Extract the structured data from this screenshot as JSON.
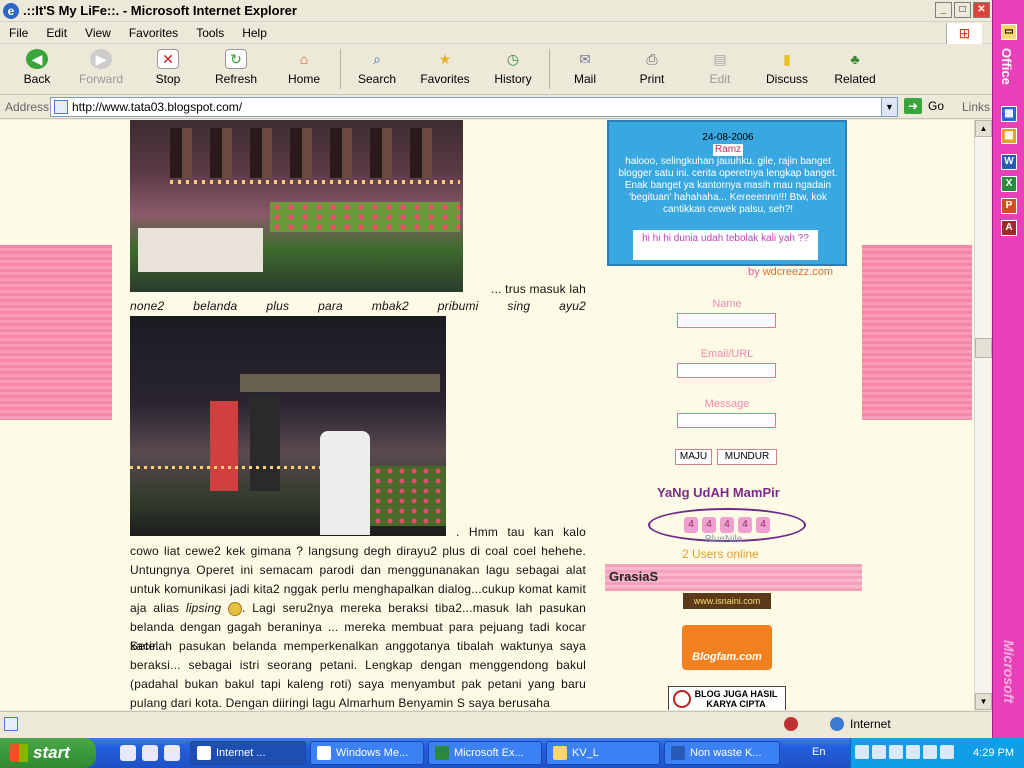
{
  "window": {
    "title": ".::It'S My LiFe::. - Microsoft Internet Explorer"
  },
  "menu": [
    "File",
    "Edit",
    "View",
    "Favorites",
    "Tools",
    "Help"
  ],
  "toolbar": {
    "back": "Back",
    "forward": "Forward",
    "stop": "Stop",
    "refresh": "Refresh",
    "home": "Home",
    "search": "Search",
    "favorites": "Favorites",
    "history": "History",
    "mail": "Mail",
    "print": "Print",
    "edit": "Edit",
    "discuss": "Discuss",
    "related": "Related"
  },
  "address": {
    "label": "Address",
    "url": "http://www.tata03.blogspot.com/",
    "go": "Go",
    "links": "Links"
  },
  "officebar": {
    "label": "Office",
    "brand": "Microsoft"
  },
  "post": {
    "line1": "... trus masuk lah",
    "line2": "none2 belanda plus para mbak2 pribumi sing ayu2",
    "para1": ". Hmm tau kan kalo cowo liat cewe2 kek gimana ? langsung degh dirayu2 plus di coal coel hehehe. Untungnya Operet ini semacam parodi dan menggunanakan lagu sebagai alat untuk komunikasi jadi kita2 nggak perlu menghapalkan dialog...cukup komat kamit aja alias",
    "lipsing": "lipsing",
    "para1b": ". Lagi seru2nya mereka beraksi tiba2...masuk lah pasukan belanda dengan gagah beraninya ... mereka membuat para pejuang tadi kocar kacir...",
    "para2": "Setelah pasukan belanda memperkenalkan anggotanya tibalah waktunya saya beraksi... sebagai istri seorang petani. Lengkap dengan menggendong bakul (padahal bukan bakul tapi kaleng roti) saya menyambut pak petani yang baru pulang dari kota. Dengan diiringi lagu Almarhum Benyamin S saya berusaha"
  },
  "shoutbox": {
    "date": "24-08-2006",
    "user": "Ramz",
    "message": "halooo, selingkuhan jauuhku. gile, rajin banget blogger satu ini. cerita operetnya lengkap banget. Enak banget ya kantornya masih mau ngadain 'begituan' hahahaha... Kereeennn!!! Btw, kok cantikkan cewek palsu, seh?!",
    "reply": "hi hi hi dunia udah tebolak kali yah ??",
    "by": "by",
    "author": "wdcreezz.com",
    "name_label": "Name",
    "email_label": "Email/URL",
    "message_label": "Message",
    "maju": "MAJU",
    "mundur": "MUNDUR"
  },
  "sidebar": {
    "visitors_title": "YaNg UdAH MamPir",
    "counter_digits": [
      "4",
      "4",
      "4",
      "4",
      "4"
    ],
    "counter_brand": "BlueNile",
    "online": "2 Users online",
    "grasias": "GrasiaS",
    "badge1": "www.isnaini.com",
    "badge2": "Blogfam.com",
    "badge3": "BLOG JUGA HASIL KARYA CIPTA"
  },
  "status": {
    "zone": "Internet"
  },
  "taskbar": {
    "start": "start",
    "tasks": [
      "Internet ...",
      "Windows Me...",
      "Microsoft Ex...",
      "KV_L",
      "Non waste K..."
    ],
    "lang": "En",
    "clock": "4:29 PM"
  }
}
